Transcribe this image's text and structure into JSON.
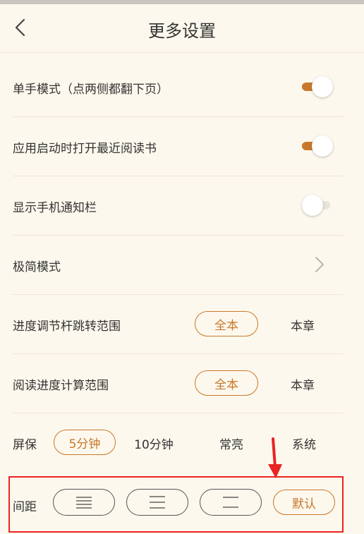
{
  "header": {
    "title": "更多设置",
    "back_icon": "chevron-left-icon"
  },
  "rows": {
    "one_hand": {
      "label": "单手模式（点两侧都翻下页）",
      "enabled": true
    },
    "open_recent": {
      "label": "应用启动时打开最近阅读书",
      "enabled": true
    },
    "notification_bar": {
      "label": "显示手机通知栏",
      "enabled": false
    },
    "minimal_mode": {
      "label": "极简模式",
      "icon": "chevron-right-icon"
    },
    "progress_range": {
      "label": "进度调节杆跳转范围",
      "options": [
        "全本",
        "本章"
      ],
      "selected": "全本"
    },
    "reading_progress": {
      "label": "阅读进度计算范围",
      "options": [
        "全本",
        "本章"
      ],
      "selected": "全本"
    },
    "screensaver": {
      "label": "屏保",
      "options": [
        "5分钟",
        "10分钟",
        "常亮",
        "系统"
      ],
      "selected": "5分钟"
    },
    "spacing": {
      "label": "间距",
      "options": [
        "narrow-spacing-icon",
        "medium-spacing-icon",
        "wide-spacing-icon"
      ],
      "default_label": "默认",
      "selected": "默认"
    }
  },
  "colors": {
    "accent": "#c8782c",
    "background": "#fdf8ed",
    "annotation": "#ea2323"
  }
}
